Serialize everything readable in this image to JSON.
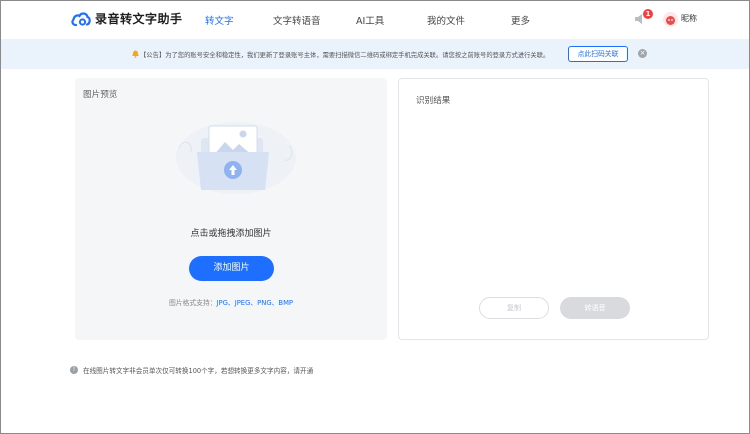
{
  "app": {
    "title": "录音转文字助手"
  },
  "nav": [
    {
      "label": "转文字",
      "active": true
    },
    {
      "label": "文字转语音",
      "active": false
    },
    {
      "label": "AI工具",
      "active": false
    },
    {
      "label": "我的文件",
      "active": false
    },
    {
      "label": "更多",
      "active": false
    }
  ],
  "user": {
    "notification_count": "1",
    "nickname": "昵称"
  },
  "notice": {
    "text": "【公告】为了您的账号安全和稳定性，我们更新了登录账号主体，需要扫描微信二维码或绑定手机完成关联。请您按之前账号的登录方式进行关联。",
    "button_label": "点此扫码关联",
    "close_icon": "close-icon"
  },
  "preview": {
    "title": "图片预览",
    "hint": "点击或拖拽添加图片",
    "add_button": "添加图片",
    "formats_label": "图片格式支持：",
    "formats": "JPG、JPEG、PNG、BMP"
  },
  "result": {
    "title": "识别结果",
    "copy_button": "复制",
    "voice_button": "转语音"
  },
  "footer": {
    "note": "在线图片转文字非会员单次仅可转换100个字，若想转换更多文字内容，请开通"
  },
  "colors": {
    "accent": "#1e6fff",
    "notice_bg": "#eaf2fc",
    "badge": "#f04141"
  }
}
